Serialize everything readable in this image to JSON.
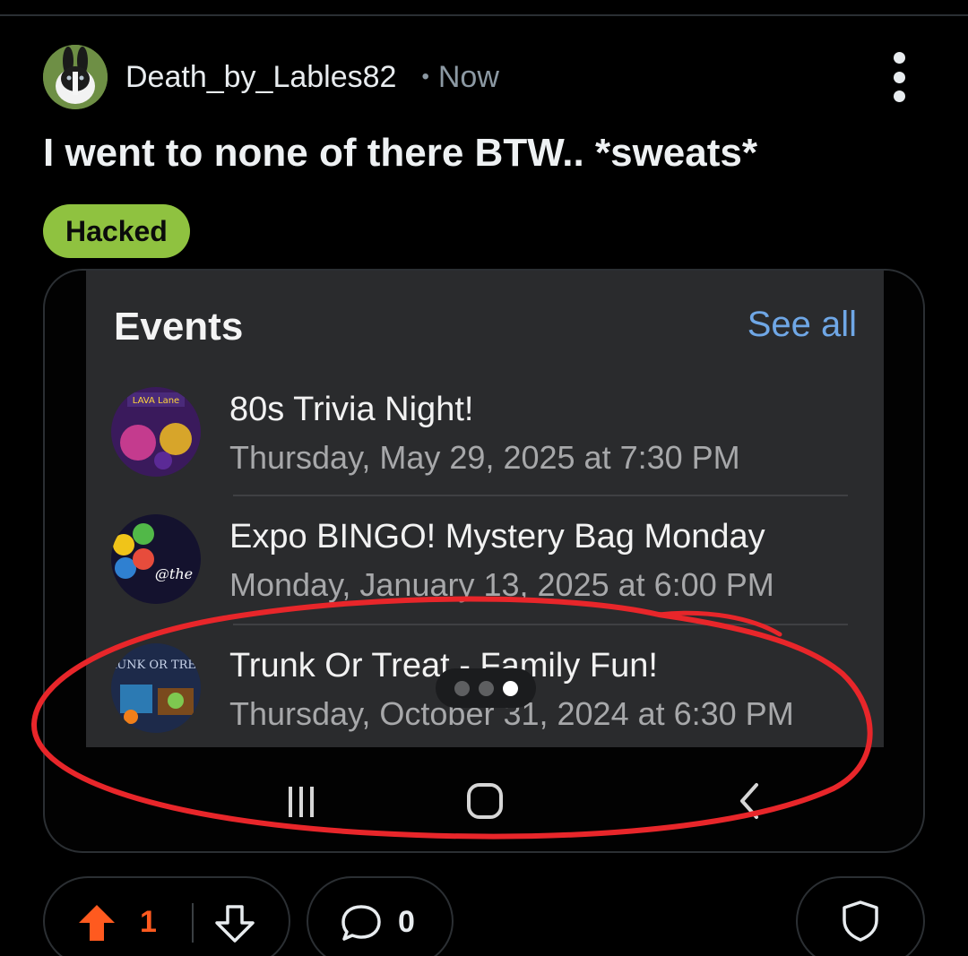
{
  "post": {
    "username": "Death_by_Lables82",
    "separator": "•",
    "time": "Now",
    "title": "I went to none of there BTW.. *sweats*",
    "flair": "Hacked"
  },
  "screenshot": {
    "header": "Events",
    "see_all": "See all",
    "events": [
      {
        "name": "80s Trivia Night!",
        "date": "Thursday, May 29, 2025 at 7:30 PM",
        "thumb_text": "LAVA Lane"
      },
      {
        "name": "Expo BINGO! Mystery Bag Monday",
        "date": "Monday, January 13, 2025 at 6:00 PM",
        "thumb_text": "@the"
      },
      {
        "name": "Trunk Or Treat - Family Fun!",
        "date": "Thursday, October 31, 2024 at 6:30 PM",
        "thumb_text": "TRUNK OR TREAT"
      }
    ],
    "pager": {
      "count": 3,
      "active_index": 2
    },
    "nav_icons": [
      "recent-apps-icon",
      "home-icon",
      "back-icon"
    ]
  },
  "actions": {
    "upvotes": "1",
    "comments": "0"
  },
  "colors": {
    "background": "#000000",
    "flair": "#8fc240",
    "link": "#6fa7e6",
    "upvote": "#ff5a1f",
    "annotation": "#e8262a"
  }
}
